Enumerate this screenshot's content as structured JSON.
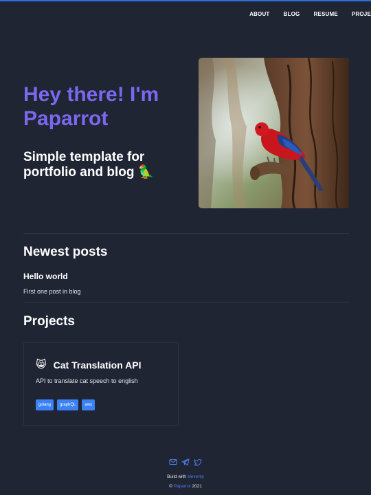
{
  "nav": {
    "items": [
      {
        "label": "ABOUT"
      },
      {
        "label": "BLOG"
      },
      {
        "label": "RESUME"
      },
      {
        "label": "PROJE"
      }
    ]
  },
  "hero": {
    "title": "Hey there! I'm Paparrot",
    "subtitle": "Simple template for portfolio and blog",
    "subtitle_emoji": "🦜",
    "image_icon": "parrot-photo"
  },
  "posts": {
    "heading": "Newest posts",
    "items": [
      {
        "title": "Hello world",
        "description": "First one post in blog"
      }
    ]
  },
  "projects": {
    "heading": "Projects",
    "items": [
      {
        "emoji": "😸",
        "title": "Cat Translation API",
        "description": "API to translate cat speech to english",
        "tags": [
          "golang",
          "graphQL",
          "aws"
        ]
      }
    ]
  },
  "footer": {
    "icons": [
      "mail-icon",
      "telegram-icon",
      "twitter-icon"
    ],
    "build_prefix": "Build with",
    "build_link": "eleventy",
    "copyright_symbol": "©",
    "copyright_link": "Paparrot",
    "copyright_year": "2021"
  },
  "colors": {
    "background": "#1f2533",
    "accent": "#7b68ee",
    "tag": "#3b82f6",
    "link": "#4f7df0",
    "top_border": "#2f6fe0"
  }
}
